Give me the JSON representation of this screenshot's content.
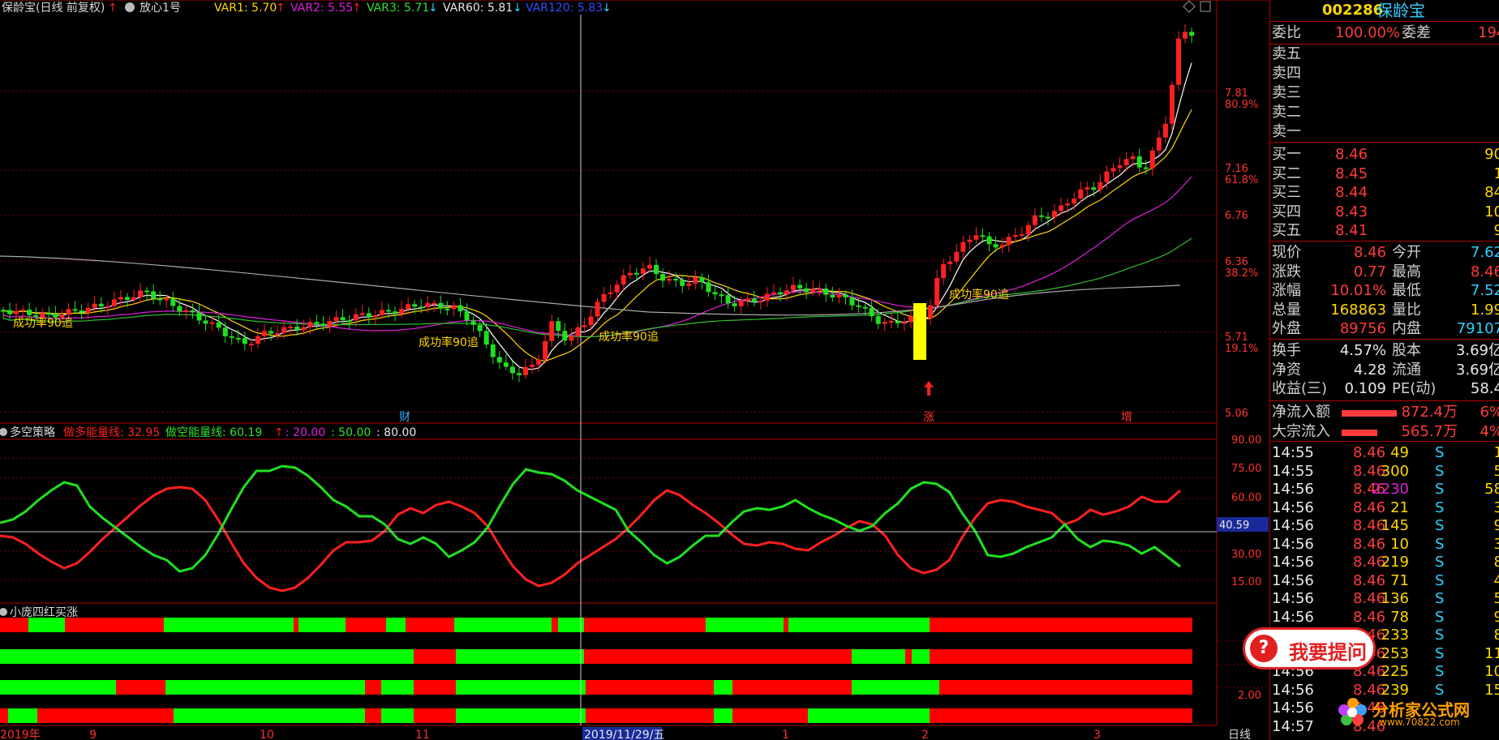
{
  "colors": {
    "up": "#ff2020",
    "down": "#20e020",
    "panel_border": "#b00000",
    "cursor": "#cfcfcf"
  },
  "header": {
    "title": "保龄宝(日线 前复权)",
    "formula": "放心1号",
    "var1": "VAR1: 5.70",
    "var2": "VAR2: 5.55",
    "var3": "VAR3: 5.71",
    "var60": "VAR60: 5.81",
    "var120": "VAR120: 5.83",
    "arrow_up": "↑",
    "arrow_down": "↓"
  },
  "price_axis": {
    "labels": [
      "7.81",
      "80.9%",
      "7.16",
      "61.8%",
      "6.76",
      "6.36",
      "38.2%",
      "5.71",
      "19.1%",
      "5.06"
    ]
  },
  "chart_signals": {
    "s1": "成功率90追",
    "s2": "成功率90追",
    "s3": "成功率90追",
    "s4": "成功率90追",
    "mark_cai": "财",
    "mark_zhang": "涨",
    "mark_zeng": "增"
  },
  "osc_panel": {
    "title": "多空策略",
    "long_label": "做多能量线: 32.95",
    "short_label": "做空能量线: 60.19",
    "l1": ": 20.00",
    "l2": ": 50.00",
    "l3": ": 80.00",
    "axis": [
      "90.00",
      "75.00",
      "60.00",
      "30.00",
      "15.00"
    ],
    "cursor_value": "40.59",
    "long_values": [
      42,
      41,
      37,
      31,
      26,
      22,
      25,
      32,
      40,
      47,
      54,
      61,
      67,
      71,
      72,
      71,
      64,
      52,
      38,
      25,
      16,
      10,
      8,
      10,
      16,
      24,
      33,
      38,
      38,
      39,
      45,
      55,
      59,
      56,
      61,
      63,
      60,
      56,
      48,
      35,
      23,
      15,
      11,
      13,
      18,
      25,
      30,
      35,
      40,
      47,
      55,
      64,
      70,
      67,
      61,
      56,
      50,
      43,
      37,
      36,
      38,
      37,
      34,
      33,
      38,
      42,
      47,
      51,
      49,
      42,
      30,
      22,
      19,
      21,
      27,
      41,
      53,
      62,
      64,
      63,
      60,
      58,
      56,
      49,
      52,
      58,
      55,
      57,
      60,
      66,
      63,
      63,
      70
    ]
  },
  "bars_panel": {
    "title": "小庞四红买涨",
    "axis": [
      "2.00"
    ]
  },
  "time_axis": {
    "labels": [
      "2019年",
      "9",
      "10",
      "11",
      "2019/11/29/五",
      "1",
      "2",
      "3"
    ],
    "period": "日线"
  },
  "quote": {
    "code": "002286",
    "name": "保龄宝",
    "weibi_label": "委比",
    "weibi_value": "100.00%",
    "weicha_label": "委差",
    "weicha_value": "194",
    "sell": [
      {
        "label": "卖五"
      },
      {
        "label": "卖四"
      },
      {
        "label": "卖三"
      },
      {
        "label": "卖二"
      },
      {
        "label": "卖一"
      }
    ],
    "buy": [
      {
        "label": "买一",
        "price": "8.46",
        "vol": "90"
      },
      {
        "label": "买二",
        "price": "8.45",
        "vol": "1"
      },
      {
        "label": "买三",
        "price": "8.44",
        "vol": "84"
      },
      {
        "label": "买四",
        "price": "8.43",
        "vol": "10"
      },
      {
        "label": "买五",
        "price": "8.41",
        "vol": "9"
      }
    ],
    "stats": [
      {
        "l1": "现价",
        "v1": "8.46",
        "l2": "今开",
        "v2": "7.62"
      },
      {
        "l1": "涨跌",
        "v1": "0.77",
        "l2": "最高",
        "v2": "8.46"
      },
      {
        "l1": "涨幅",
        "v1": "10.01%",
        "l2": "最低",
        "v2": "7.52"
      },
      {
        "l1": "总量",
        "v1": "168863",
        "l2": "量比",
        "v2": "1.99"
      },
      {
        "l1": "外盘",
        "v1": "89756",
        "l2": "内盘",
        "v2": "79107"
      }
    ],
    "fin": [
      {
        "l1": "换手",
        "v1": "4.57%",
        "l2": "股本",
        "v2": "3.69亿"
      },
      {
        "l1": "净资",
        "v1": "4.28",
        "l2": "流通",
        "v2": "3.69亿"
      },
      {
        "l1": "收益(三)",
        "v1": "0.109",
        "l2": "PE(动)",
        "v2": "58.4"
      }
    ],
    "flow": [
      {
        "label": "净流入额",
        "value": "872.4万",
        "pct": "6%"
      },
      {
        "label": "大宗流入",
        "value": "565.7万",
        "pct": "4%"
      }
    ],
    "ticks": [
      {
        "t": "14:55",
        "p": "8.46",
        "v": "49",
        "s": "S",
        "n": "1"
      },
      {
        "t": "14:55",
        "p": "8.46",
        "v": "300",
        "s": "S",
        "n": "5"
      },
      {
        "t": "14:56",
        "p": "8.46",
        "v": "2230",
        "s": "S",
        "n": "58"
      },
      {
        "t": "14:56",
        "p": "8.46",
        "v": "21",
        "s": "S",
        "n": "3"
      },
      {
        "t": "14:56",
        "p": "8.46",
        "v": "145",
        "s": "S",
        "n": "9"
      },
      {
        "t": "14:56",
        "p": "8.46",
        "v": "10",
        "s": "S",
        "n": "3"
      },
      {
        "t": "14:56",
        "p": "8.46",
        "v": "219",
        "s": "S",
        "n": "8"
      },
      {
        "t": "14:56",
        "p": "8.46",
        "v": "71",
        "s": "S",
        "n": "4"
      },
      {
        "t": "14:56",
        "p": "8.46",
        "v": "136",
        "s": "S",
        "n": "5"
      },
      {
        "t": "14:56",
        "p": "8.46",
        "v": "78",
        "s": "S",
        "n": "9"
      },
      {
        "t": "14:56",
        "p": "8.46",
        "v": "233",
        "s": "S",
        "n": "8"
      },
      {
        "t": "14:56",
        "p": "8.46",
        "v": "253",
        "s": "S",
        "n": "11"
      },
      {
        "t": "14:56",
        "p": "8.46",
        "v": "225",
        "s": "S",
        "n": "10"
      },
      {
        "t": "14:56",
        "p": "8.46",
        "v": "239",
        "s": "S",
        "n": "15"
      },
      {
        "t": "14:56",
        "p": "8.46",
        "v": "",
        "s": "",
        "n": ""
      },
      {
        "t": "14:57",
        "p": "8.46",
        "v": "",
        "s": "",
        "n": ""
      }
    ]
  },
  "overlays": {
    "ask_icon": "?",
    "ask_label": "我要提问",
    "logo_name": "分析家公式网",
    "logo_url": "www.70822.com"
  }
}
